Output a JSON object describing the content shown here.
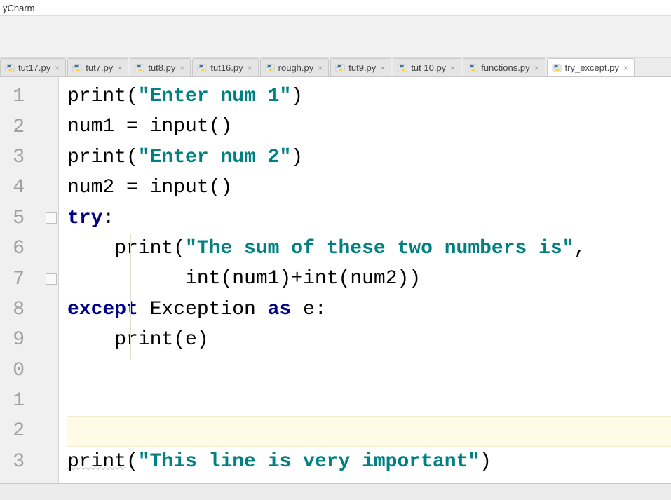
{
  "title": "yCharm",
  "tabs": [
    {
      "label": "tut17.py",
      "active": false
    },
    {
      "label": "tut7.py",
      "active": false
    },
    {
      "label": "tut8.py",
      "active": false
    },
    {
      "label": "tut16.py",
      "active": false
    },
    {
      "label": "rough.py",
      "active": false
    },
    {
      "label": "tut9.py",
      "active": false
    },
    {
      "label": "tut 10.py",
      "active": false
    },
    {
      "label": "functions.py",
      "active": false
    },
    {
      "label": "try_except.py",
      "active": true
    }
  ],
  "gutter": {
    "lines": [
      "1",
      "2",
      "3",
      "4",
      "5",
      "6",
      "7",
      "8",
      "9",
      "0",
      "1",
      "2",
      "3"
    ],
    "fold_positions": [
      5,
      7
    ]
  },
  "code": {
    "current_line_index": 11,
    "lines": [
      {
        "t": [
          [
            "func",
            "print"
          ],
          [
            "punc",
            "("
          ],
          [
            "str",
            "\"Enter num 1\""
          ],
          [
            "punc",
            ")"
          ]
        ]
      },
      {
        "t": [
          [
            "ident",
            "num1 "
          ],
          [
            "punc",
            "= "
          ],
          [
            "func",
            "input"
          ],
          [
            "punc",
            "()"
          ]
        ]
      },
      {
        "t": [
          [
            "func",
            "print"
          ],
          [
            "punc",
            "("
          ],
          [
            "str",
            "\"Enter num 2\""
          ],
          [
            "punc",
            ")"
          ]
        ]
      },
      {
        "t": [
          [
            "ident",
            "num2 "
          ],
          [
            "punc",
            "= "
          ],
          [
            "func",
            "input"
          ],
          [
            "punc",
            "()"
          ]
        ]
      },
      {
        "t": [
          [
            "kw",
            "try"
          ],
          [
            "punc",
            ":"
          ]
        ]
      },
      {
        "t": [
          [
            "ident",
            "    "
          ],
          [
            "func",
            "print"
          ],
          [
            "punc",
            "("
          ],
          [
            "str",
            "\"The sum of these two numbers is\""
          ],
          [
            "punc",
            ","
          ]
        ]
      },
      {
        "t": [
          [
            "ident",
            "          "
          ],
          [
            "func",
            "int"
          ],
          [
            "punc",
            "("
          ],
          [
            "ident",
            "num1"
          ],
          [
            "punc",
            ")+"
          ],
          [
            "func",
            "int"
          ],
          [
            "punc",
            "("
          ],
          [
            "ident",
            "num2"
          ],
          [
            "punc",
            "))"
          ]
        ]
      },
      {
        "t": [
          [
            "kw",
            "except"
          ],
          [
            "ident",
            " Exception "
          ],
          [
            "kw",
            "as"
          ],
          [
            "ident",
            " e"
          ],
          [
            "punc",
            ":"
          ]
        ]
      },
      {
        "t": [
          [
            "ident",
            "    "
          ],
          [
            "func",
            "print"
          ],
          [
            "punc",
            "("
          ],
          [
            "ident",
            "e"
          ],
          [
            "punc",
            ")"
          ]
        ]
      },
      {
        "t": []
      },
      {
        "t": []
      },
      {
        "t": []
      },
      {
        "t": [
          [
            "func_wavy",
            "print"
          ],
          [
            "punc",
            "("
          ],
          [
            "str",
            "\"This line is very important\""
          ],
          [
            "punc",
            ")"
          ]
        ]
      }
    ]
  },
  "icons": {
    "py_file": "py-file-icon",
    "close": "×",
    "fold_minus": "−"
  }
}
